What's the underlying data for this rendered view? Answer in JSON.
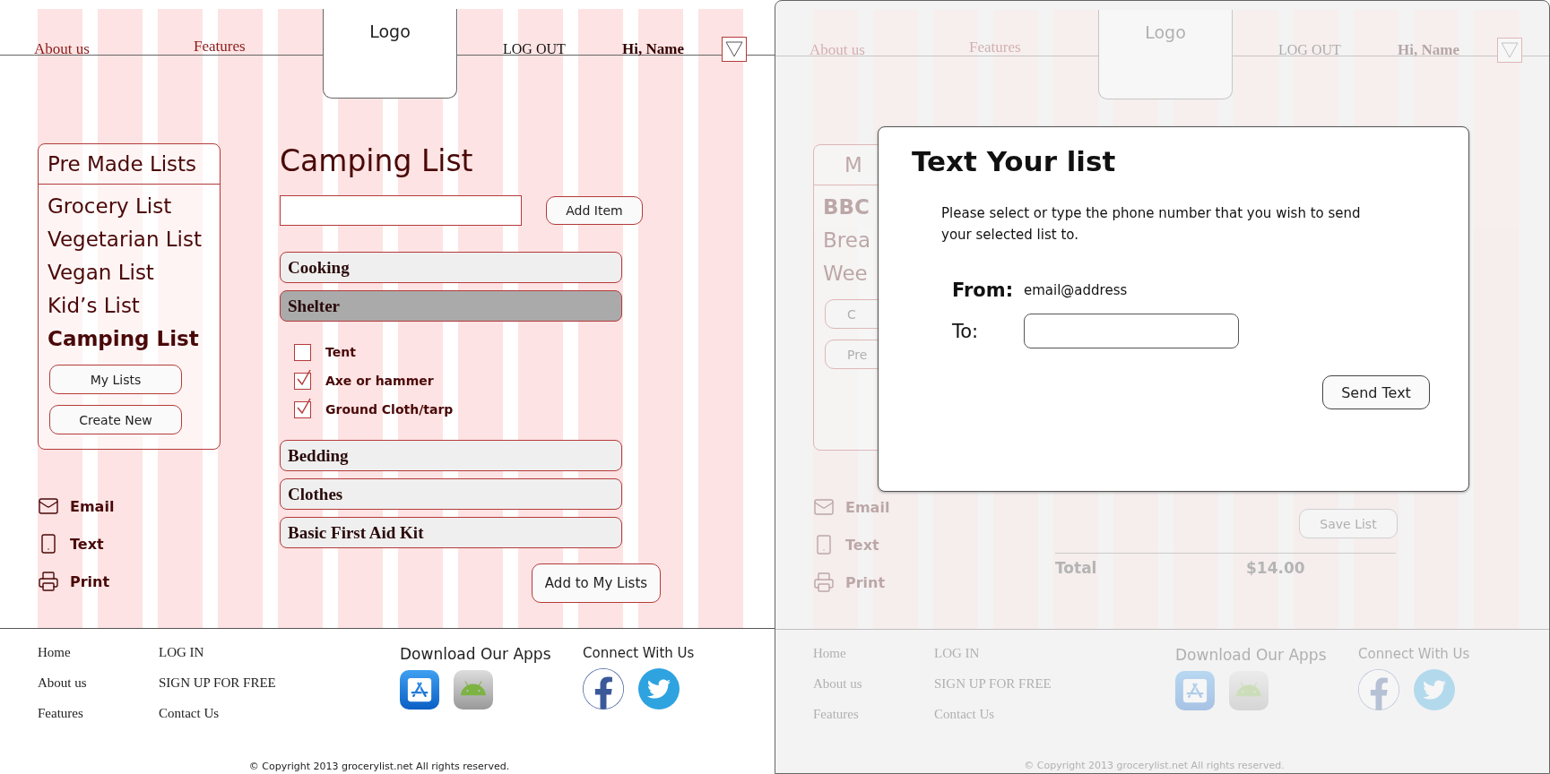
{
  "left_screen": {
    "nav": {
      "links": [
        {
          "label": "About us"
        },
        {
          "label": "Features"
        }
      ],
      "logo": "Logo",
      "logout": "LOG OUT",
      "greeting": "Hi, Name"
    },
    "sidebar": {
      "title": "Pre Made Lists",
      "items": [
        {
          "label": "Grocery List",
          "selected": false
        },
        {
          "label": "Vegetarian List",
          "selected": false
        },
        {
          "label": "Vegan List",
          "selected": false
        },
        {
          "label": "Kid’s List",
          "selected": false
        },
        {
          "label": "Camping List",
          "selected": true
        }
      ],
      "buttons": [
        "My Lists",
        "Create New"
      ]
    },
    "share": [
      {
        "kind": "email",
        "label": "Email"
      },
      {
        "kind": "text",
        "label": "Text"
      },
      {
        "kind": "print",
        "label": "Print"
      }
    ],
    "list": {
      "title": "Camping List",
      "add_button": "Add Item",
      "categories": [
        {
          "label": "Cooking",
          "expanded": false
        },
        {
          "label": "Shelter",
          "expanded": true,
          "items": [
            {
              "label": "Tent",
              "checked": false
            },
            {
              "label": "Axe or hammer",
              "checked": true
            },
            {
              "label": "Ground Cloth/tarp",
              "checked": true
            }
          ]
        },
        {
          "label": "Bedding",
          "expanded": false
        },
        {
          "label": "Clothes",
          "expanded": false
        },
        {
          "label": "Basic First Aid Kit",
          "expanded": false
        }
      ],
      "save_button": "Add to My Lists"
    },
    "footer": {
      "links_col1": [
        "Home",
        "About us",
        "Features"
      ],
      "links_col2": [
        "LOG IN",
        "SIGN UP FOR FREE",
        "Contact Us"
      ],
      "apps_heading": "Download Our Apps",
      "social_heading": "Connect With Us",
      "copyright": "© Copyright 2013 grocerylist.net All rights reserved."
    }
  },
  "right_screen": {
    "nav": {
      "links": [
        {
          "label": "About us"
        },
        {
          "label": "Features"
        }
      ],
      "logo": "Logo",
      "logout": "LOG OUT",
      "greeting": "Hi, Name"
    },
    "sidebar": {
      "title": "M",
      "items": [
        {
          "label": "BBC",
          "selected": true
        },
        {
          "label": "Brea",
          "selected": false
        },
        {
          "label": "Wee",
          "selected": false
        }
      ],
      "buttons": [
        "C",
        "Pre"
      ]
    },
    "share": [
      {
        "kind": "email",
        "label": "Email"
      },
      {
        "kind": "text",
        "label": "Text"
      },
      {
        "kind": "print",
        "label": "Print"
      }
    ],
    "summary": {
      "save_button": "Save List",
      "total_label": "Total",
      "total_value": "$14.00"
    },
    "footer": {
      "links_col1": [
        "Home",
        "About us",
        "Features"
      ],
      "links_col2": [
        "LOG IN",
        "SIGN UP FOR FREE",
        "Contact Us"
      ],
      "apps_heading": "Download Our Apps",
      "social_heading": "Connect With Us",
      "copyright": "© Copyright 2013 grocerylist.net All rights reserved."
    },
    "dialog": {
      "title": "Text Your list",
      "message": "Please select or type the phone number that you wish to send your selected list to.",
      "from_label": "From:",
      "from_value": "email@address",
      "to_label": "To:",
      "send_button": "Send Text"
    }
  }
}
